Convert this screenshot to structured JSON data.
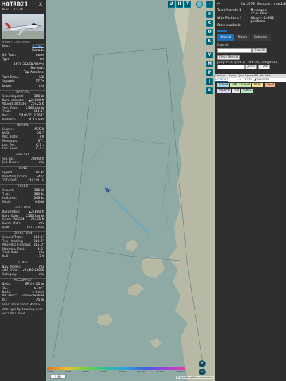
{
  "left": {
    "callsign": "HOTRD21",
    "hex_label": "Hex:",
    "hex": "C01276",
    "close": "X",
    "photo_credit": "Image © Chris Lofting",
    "basic_rows": [
      {
        "k": "Reg.:",
        "v": "C-FGZT",
        "link": true
      },
      {
        "k": "",
        "v": "Canada",
        "link": false
      },
      {
        "k": "DB flags:",
        "v": "none",
        "link": false
      },
      {
        "k": "Type:",
        "v": "A4",
        "link": false
      },
      {
        "k": "",
        "v": "1976 DOUGLAS A-4",
        "link": false
      },
      {
        "k": "",
        "v": "Skyhawk",
        "link": false
      },
      {
        "k": "",
        "v": "Top Aces Inc.",
        "link": false
      },
      {
        "k": "Type Desc.:",
        "v": "L1J",
        "link": false
      },
      {
        "k": "Squawk:",
        "v": "7770",
        "link": false
      },
      {
        "k": "Route:",
        "v": "n/a",
        "link": false
      }
    ],
    "sections": [
      {
        "title": "SPATIAL",
        "rows": [
          {
            "k": "Groundspeed:",
            "v": "306 kt"
          },
          {
            "k": "Baro. altitude:",
            "v": "▲24800 ft"
          },
          {
            "k": "WGS84 altitude:",
            "v": "25425 ft"
          },
          {
            "k": "Vert. Rate:",
            "v": "2560 ft/min"
          },
          {
            "k": "Track:",
            "v": "313.5°"
          },
          {
            "k": "Pos.:",
            "v": "54.053°, 8.367°"
          },
          {
            "k": "Distance:",
            "v": "101.5 nmi"
          }
        ]
      },
      {
        "title": "SIGNAL",
        "rows": [
          {
            "k": "Source:",
            "v": "ADS-B"
          },
          {
            "k": "RSSI:",
            "v": "-25.7"
          },
          {
            "k": "Msg. Rate:",
            "v": "7.0"
          },
          {
            "k": "Messages:",
            "v": "371"
          },
          {
            "k": "Last Pos.:",
            "v": "6.7 s"
          },
          {
            "k": "Last Seen:",
            "v": "0.4 s"
          }
        ]
      },
      {
        "title": "FMS SEL",
        "rows": [
          {
            "k": "Sel. Alt.:",
            "v": "28000 ft"
          },
          {
            "k": "Sel. Head.:",
            "v": "n/a"
          }
        ]
      },
      {
        "title": "WIND",
        "rows": [
          {
            "k": "Speed:",
            "v": "61 kt"
          },
          {
            "k": "Direction (from):",
            "v": "345°"
          },
          {
            "k": "TAT / OAT:",
            "v": "-8 / -26 °C"
          }
        ]
      },
      {
        "title": "SPEED",
        "rows": [
          {
            "k": "Ground:",
            "v": "306 kt"
          },
          {
            "k": "True:",
            "v": "360 kt"
          },
          {
            "k": "Indicated:",
            "v": "243 kt"
          },
          {
            "k": "Mach:",
            "v": "0.588"
          }
        ]
      },
      {
        "title": "ALTITUDE",
        "rows": [
          {
            "k": "Barometric:",
            "v": "▲24800 ft"
          },
          {
            "k": "Baro. Rate:",
            "v": "2560 ft/min"
          },
          {
            "k": "Geom. WGS84:",
            "v": "25425 ft"
          },
          {
            "k": "Geom. Rate:",
            "v": "n/a"
          },
          {
            "k": "QNH:",
            "v": "1013.6 hPa"
          }
        ]
      },
      {
        "title": "DIRECTION",
        "rows": [
          {
            "k": "Ground Track:",
            "v": "313.5°"
          },
          {
            "k": "True Heading:",
            "v": "318.7°"
          },
          {
            "k": "Magnetic Heading:",
            "v": "315.0°"
          },
          {
            "k": "Magnetic Decl.:",
            "v": "3.6°"
          },
          {
            "k": "Track Rate:",
            "v": "n/a"
          },
          {
            "k": "Roll:",
            "v": "-3.8"
          }
        ]
      },
      {
        "title": "STUFF",
        "rows": [
          {
            "k": "Nav. Modes:",
            "v": "n/a"
          },
          {
            "k": "ADS-B Ver.:",
            "v": "v2 (DO-260B)"
          },
          {
            "k": "Category:",
            "v": "n/a"
          }
        ]
      },
      {
        "title": "ACCURACY",
        "rows": [
          {
            "k": "NACₚ:",
            "v": "EPU < 10 m"
          },
          {
            "k": "SIL:",
            "v": "≤ 1e-7"
          },
          {
            "k": "NACᵥ:",
            "v": "< 3 m/s"
          },
          {
            "k": "NICBARO:",
            "v": "cross-checked"
          },
          {
            "k": "Rc:",
            "v": "75 m"
          }
        ]
      }
    ],
    "footnote": "Learn more about Mode S data type by hovering over each data label."
  },
  "map": {
    "top_buttons": [
      "U",
      "H",
      "T"
    ],
    "side_buttons": [
      "C",
      "O",
      "K",
      "V",
      "M",
      "P",
      "I",
      "R"
    ],
    "zoom_in": "+",
    "zoom_out": "−",
    "scale_text": "5 NM",
    "attribution": "© OpenStreetMap contributors",
    "altitude_ticks": [
      "2 000",
      "4 000",
      "6 000",
      "8 000",
      "10 000",
      "20 000",
      "30 000",
      "40 000+"
    ]
  },
  "right": {
    "brand": "tar1090",
    "decoder_text": "decoder:",
    "decoder_link": "readsb",
    "stats": [
      {
        "k": "Total Aircraft:",
        "v": "1"
      },
      {
        "k": "Messages:",
        "v": "1578.8/sec"
      },
      {
        "k": "With Position:",
        "v": "1"
      },
      {
        "k": "History:",
        "v": "24862 positions"
      },
      {
        "k": "Stats available",
        "v": ""
      }
    ],
    "tabs": [
      "Search",
      "Filters",
      "Columns"
    ],
    "search_label": "Search:",
    "search_button": "Search",
    "clear_search": "Clear Search",
    "jump_label": "Jump to Airport or Latitude, Longitude:",
    "jump_button": "Jump",
    "clear_button": "Clear",
    "table_headers": [
      "Callsign",
      "Route",
      "Type",
      "Squawk",
      "Alt. (ft)",
      "Spd"
    ],
    "table_rows": [
      [
        "HOTRD21",
        "",
        "A4",
        "7770",
        "▲24800",
        "30"
      ]
    ],
    "legend": [
      {
        "label": "ADS-B",
        "color": "#a8d4e8"
      },
      {
        "label": "UAT / ADS-R",
        "color": "#c8e8a8"
      },
      {
        "label": "MLAT",
        "color": "#f8e090"
      },
      {
        "label": "TIS-B",
        "color": "#f0b090"
      },
      {
        "label": "Mode-S",
        "color": "#d8d8f0"
      },
      {
        "label": "AIS",
        "color": "#e8e8e8"
      },
      {
        "label": "ADS-C",
        "color": "#b8e8c8"
      }
    ]
  },
  "colors": {
    "panel": "#2f2f2f",
    "sea": "#8fa9a4",
    "land": "#b7b9a4",
    "accent": "#1f6fb8",
    "map_button": "#00596b"
  }
}
